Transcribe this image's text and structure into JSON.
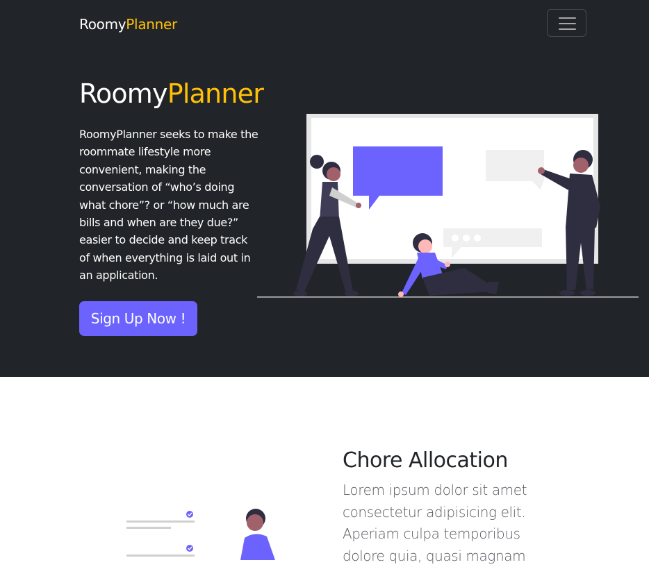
{
  "nav": {
    "brand_part1": "Roomy",
    "brand_part2": "Planner",
    "toggler_icon": "hamburger-menu-icon"
  },
  "hero": {
    "title_part1": "Roomy",
    "title_part2": "Planner",
    "description": "RoomyPlanner seeks to make the roommate lifestyle more convenient, making the conversation of “who’s doing what chore”? or “how much are bills and when are they due?” easier to decide and keep track of when everything is laid out in an application.",
    "cta_label": "Sign Up Now !",
    "illustration": "people-presentation-illustration"
  },
  "features": {
    "chore": {
      "title": "Chore Allocation",
      "text": "Lorem ipsum dolor sit amet consectetur adipisicing elit. Aperiam culpa temporibus dolore quia, quasi magnam",
      "illustration": "person-checklist-illustration"
    }
  },
  "colors": {
    "hero_bg": "#212529",
    "accent_yellow": "#ffc107",
    "primary_purple": "#6c63ff",
    "text_white": "#ffffff",
    "heading_dark": "#212529",
    "body_gray": "#565a60"
  }
}
